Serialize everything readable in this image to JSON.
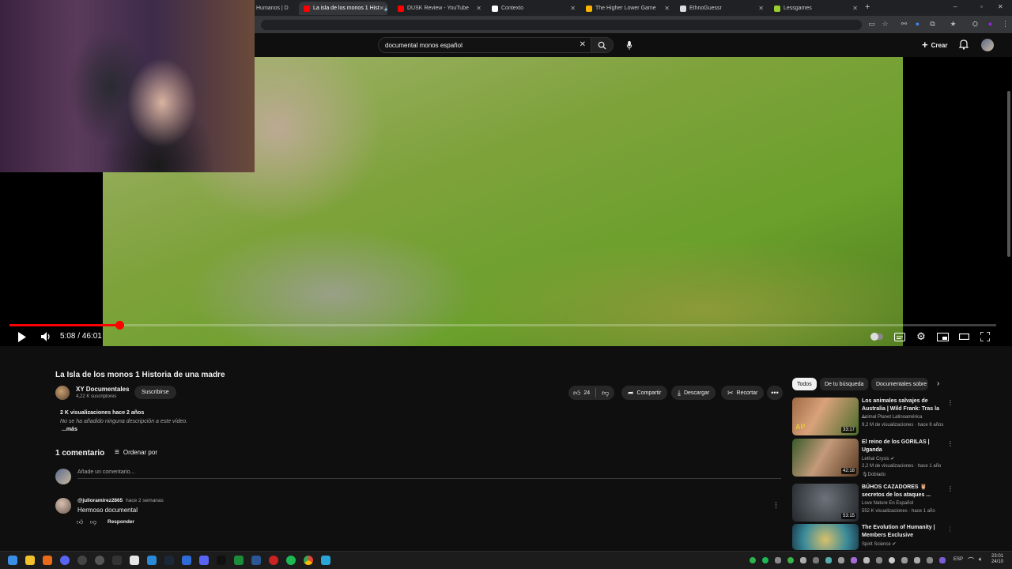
{
  "browser": {
    "tabs": [
      {
        "label": "Humanos | D",
        "active": false,
        "color": "#cc0000"
      },
      {
        "label": "La isla de los monos 1 Hist",
        "active": true,
        "color": "#ff0000"
      },
      {
        "label": "DUSK Review - YouTube",
        "active": false,
        "color": "#ff0000"
      },
      {
        "label": "Contexto",
        "active": false,
        "color": "#ffffff"
      },
      {
        "label": "The Higher Lower Game",
        "active": false,
        "color": "#ffb300"
      },
      {
        "label": "EthnoGuessr",
        "active": false,
        "color": "#dddddd"
      },
      {
        "label": "Lessgames",
        "active": false,
        "color": "#9acd32"
      }
    ],
    "new_tab": "+",
    "window_controls": {
      "minimize": "–",
      "maximize": "▫",
      "close": "✕"
    }
  },
  "header": {
    "search_value": "documental monos español",
    "create_label": "Crear"
  },
  "player": {
    "time": "5:08 / 46:01",
    "progress": 0.111
  },
  "video": {
    "title": "La Isla de los monos 1 Historia de una madre",
    "channel": "XY Documentales",
    "subscribers": "4,22 K suscriptores",
    "subscribe_label": "Suscribirse",
    "likes": "24",
    "share_label": "Compartir",
    "download_label": "Descargar",
    "clip_label": "Recortar",
    "views_date": "2 K visualizaciones  hace 2 años",
    "description": "No se ha añadido ninguna descripción a este vídeo.",
    "more_label": "...más"
  },
  "comments": {
    "count_label": "1 comentario",
    "sort_label": "Ordenar por",
    "add_placeholder": "Añade un comentario...",
    "items": [
      {
        "author": "@julioramirez2865",
        "time": "hace 2 semanas",
        "text": "Hermoso documental",
        "reply_label": "Responder"
      }
    ]
  },
  "chips": [
    "Todos",
    "De tu búsqueda",
    "Documentales sobre"
  ],
  "recommendations": [
    {
      "title": "Los animales salvajes de Australia | Wild Frank: Tras la ...",
      "channel": "Animal Planet Latinoamérica",
      "meta": "9,2 M de visualizaciones · hace 6 años",
      "duration": "33:17",
      "badge": "",
      "thumb_color": "#8a5a3c"
    },
    {
      "title": "El reino de los GORILAS | Uganda",
      "channel": "Lethal Crysis",
      "meta": "2,2 M de visualizaciones · hace 1 año",
      "duration": "42:18",
      "badge": "Doblado",
      "thumb_color": "#6b4a2e"
    },
    {
      "title": "BÚHOS CAZADORES 🦉 secretos de los ataques ...",
      "channel": "Love Nature En Español",
      "meta": "552 K visualizaciones · hace 1 año",
      "duration": "53:15",
      "badge": "",
      "thumb_color": "#3a3f44"
    },
    {
      "title": "The Evolution of Humanity | Members Exclusive",
      "channel": "Spirit Science",
      "meta": "",
      "duration": "",
      "badge": "",
      "thumb_color": "#4aa0a8"
    }
  ],
  "taskbar": {
    "lang": "ESP",
    "time": "23:01",
    "date": "24/10"
  }
}
